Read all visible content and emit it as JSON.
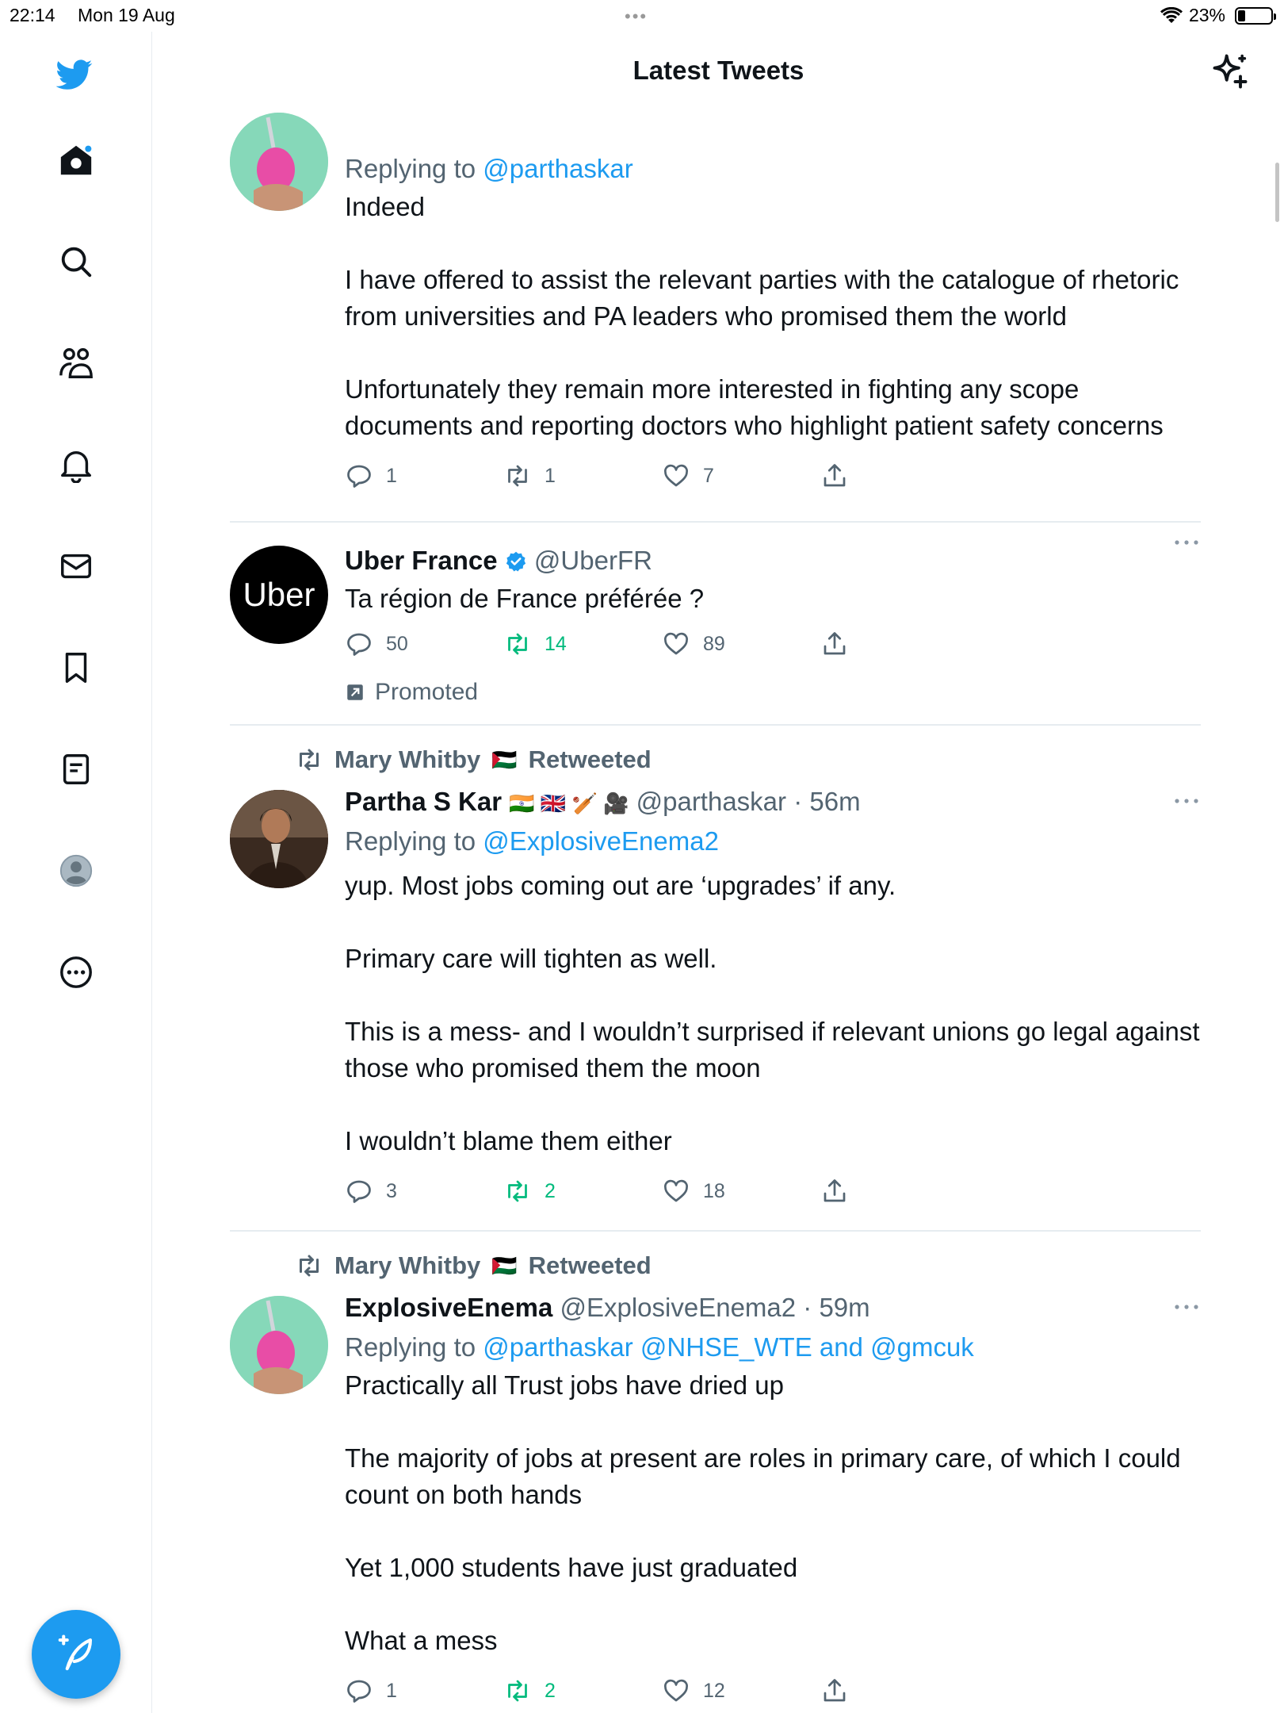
{
  "status": {
    "time": "22:14",
    "date": "Mon 19 Aug",
    "battery_text": "23%",
    "battery_level": 0.23
  },
  "header": {
    "title": "Latest Tweets",
    "sparkle_icon": "sparkle-icon"
  },
  "sidebar": {
    "icons": [
      "twitter-logo-icon",
      "home-icon",
      "search-icon",
      "communities-icon",
      "notifications-icon",
      "messages-icon",
      "bookmarks-icon",
      "lists-icon",
      "profile-icon",
      "more-icon"
    ],
    "compose_icon": "compose-icon"
  },
  "colors": {
    "accent": "#1d9bf0",
    "retweet_green": "#00ba7c",
    "muted": "#536471"
  },
  "tweets": [
    {
      "reply_prefix": "Replying to",
      "reply_to": "@parthaskar",
      "body": [
        "Indeed",
        "I have offered to assist the relevant parties with the catalogue of rhetoric from universities and PA leaders who promised them the world",
        "Unfortunately they remain more interested in fighting any scope documents and reporting doctors who highlight patient safety concerns"
      ],
      "replies": "1",
      "retweets": "1",
      "likes": "7"
    },
    {
      "name": "Uber France",
      "handle": "@UberFR",
      "avatar_text": "Uber",
      "body": [
        "Ta région de France préférée ?"
      ],
      "replies": "50",
      "retweets": "14",
      "likes": "89",
      "promoted": "Promoted"
    },
    {
      "retweeted_by": "Mary Whitby",
      "retweeted_flag": "🇵🇸",
      "retweeted_label": "Retweeted",
      "name": "Partha S Kar",
      "name_emoji": "🇮🇳 🇬🇧 🏏 🎥",
      "handle": "@parthaskar",
      "time": "· 56m",
      "reply_prefix": "Replying to",
      "reply_to": "@ExplosiveEnema2",
      "body": [
        "yup. Most jobs coming out are ‘upgrades’ if any.",
        "Primary care will tighten as well.",
        "This is a mess- and I wouldn’t surprised if relevant unions go legal against those who promised them the moon",
        "I wouldn’t blame them either"
      ],
      "replies": "3",
      "retweets": "2",
      "likes": "18"
    },
    {
      "retweeted_by": "Mary Whitby",
      "retweeted_flag": "🇵🇸",
      "retweeted_label": "Retweeted",
      "name": "ExplosiveEnema",
      "handle": "@ExplosiveEnema2",
      "time": "· 59m",
      "reply_prefix": "Replying to",
      "reply_to": "@parthaskar @NHSE_WTE and @gmcuk",
      "body": [
        "Practically all Trust jobs have dried up",
        "The majority of jobs at present are roles in primary care, of which I could count on both hands",
        "Yet 1,000 students have just graduated",
        "What a mess"
      ],
      "replies": "1",
      "retweets": "2",
      "likes": "12"
    }
  ]
}
